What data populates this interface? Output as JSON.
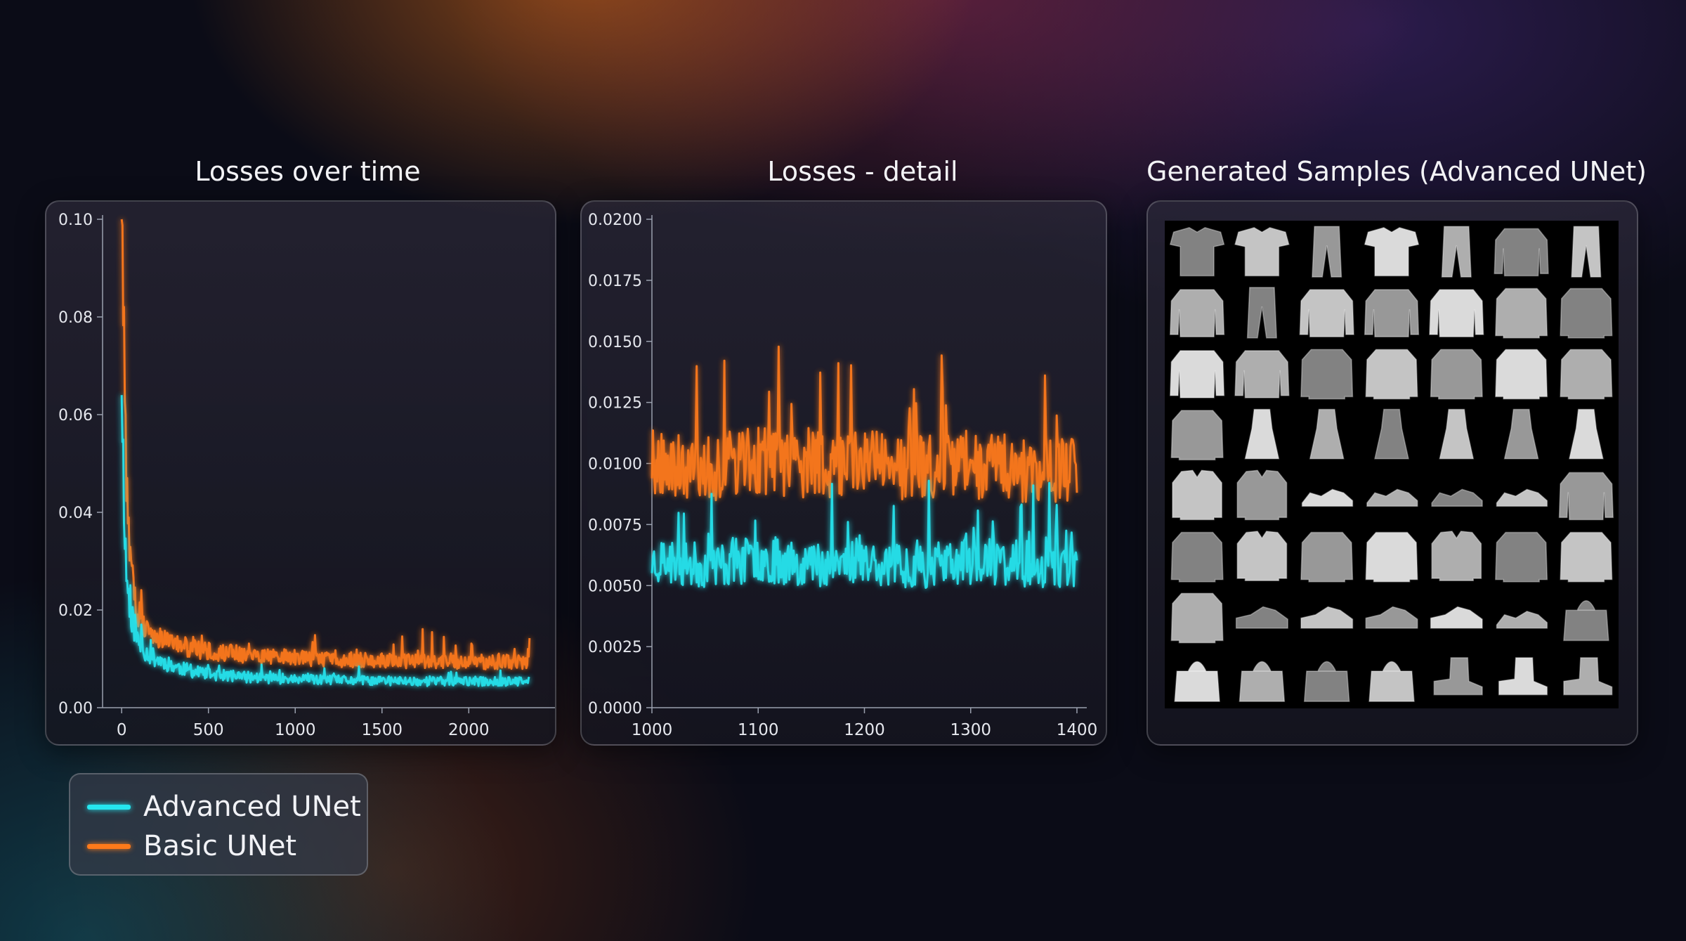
{
  "colors": {
    "advanced": "#25e6f0",
    "basic": "#ff7a1a"
  },
  "legend": {
    "items": [
      {
        "label": "Advanced UNet",
        "color": "#25e6f0"
      },
      {
        "label": "Basic UNet",
        "color": "#ff7a1a"
      }
    ]
  },
  "chart_data": [
    {
      "type": "line",
      "title": "Losses over time",
      "xlabel": "",
      "ylabel": "",
      "xlim": [
        -110,
        2440
      ],
      "ylim": [
        0,
        0.1
      ],
      "xticks": [
        "0",
        "500",
        "1000",
        "1500",
        "2000"
      ],
      "yticks": [
        "0.00",
        "0.02",
        "0.04",
        "0.06",
        "0.08",
        "0.10"
      ],
      "grid": false,
      "x": [
        0,
        25,
        50,
        75,
        100,
        150,
        200,
        300,
        400,
        500,
        750,
        1000,
        1250,
        1500,
        1750,
        2000,
        2350
      ],
      "series": [
        {
          "name": "Advanced UNet",
          "color": "#25e6f0",
          "values": [
            0.064,
            0.028,
            0.02,
            0.016,
            0.013,
            0.011,
            0.01,
            0.0085,
            0.0075,
            0.0068,
            0.0062,
            0.0058,
            0.0056,
            0.0055,
            0.0054,
            0.0054,
            0.0053
          ]
        },
        {
          "name": "Basic UNet",
          "color": "#ff7a1a",
          "values": [
            0.1,
            0.05,
            0.03,
            0.022,
            0.019,
            0.016,
            0.0145,
            0.013,
            0.0122,
            0.0115,
            0.0108,
            0.0102,
            0.0099,
            0.0097,
            0.0095,
            0.0094,
            0.0093
          ]
        }
      ]
    },
    {
      "type": "line",
      "title": "Losses - detail",
      "xlabel": "",
      "ylabel": "",
      "xlim": [
        1000,
        1400
      ],
      "ylim": [
        0,
        0.02
      ],
      "xticks": [
        "1000",
        "1100",
        "1200",
        "1300",
        "1400"
      ],
      "yticks": [
        "0.0000",
        "0.0025",
        "0.0050",
        "0.0075",
        "0.0100",
        "0.0125",
        "0.0150",
        "0.0175",
        "0.0200"
      ],
      "grid": false,
      "x": [
        1000,
        1050,
        1100,
        1150,
        1200,
        1250,
        1300,
        1350,
        1400
      ],
      "series": [
        {
          "name": "Advanced UNet",
          "color": "#25e6f0",
          "values": [
            0.006,
            0.0058,
            0.0061,
            0.0059,
            0.006,
            0.0058,
            0.006,
            0.0059,
            0.0058
          ]
        },
        {
          "name": "Basic UNet",
          "color": "#ff7a1a",
          "values": [
            0.01,
            0.0098,
            0.0101,
            0.0099,
            0.01,
            0.0098,
            0.0099,
            0.0098,
            0.0097
          ]
        }
      ],
      "peaks": {
        "basic_max": 0.0149,
        "advanced_min": 0.004
      }
    }
  ],
  "samples": {
    "title": "Generated Samples (Advanced UNet)",
    "rows": 8,
    "cols": 7,
    "grid": [
      [
        "tshirt",
        "tshirt",
        "trouser",
        "tshirt",
        "trouser",
        "pullover",
        "trouser"
      ],
      [
        "pullover",
        "trouser",
        "pullover",
        "pullover",
        "pullover",
        "coat",
        "coat"
      ],
      [
        "pullover",
        "pullover",
        "coat",
        "coat",
        "coat",
        "coat",
        "coat"
      ],
      [
        "coat",
        "dress",
        "dress",
        "dress",
        "dress",
        "dress",
        "dress"
      ],
      [
        "shirt",
        "shirt",
        "sandal",
        "sandal",
        "sandal",
        "sandal",
        "pullover"
      ],
      [
        "coat",
        "shirt",
        "coat",
        "coat",
        "shirt",
        "coat",
        "coat"
      ],
      [
        "coat",
        "sneaker",
        "sneaker",
        "sneaker",
        "sneaker",
        "sandal",
        "bag"
      ],
      [
        "bag",
        "bag",
        "bag",
        "bag",
        "ankle-boot",
        "ankle-boot",
        "ankle-boot"
      ]
    ]
  }
}
